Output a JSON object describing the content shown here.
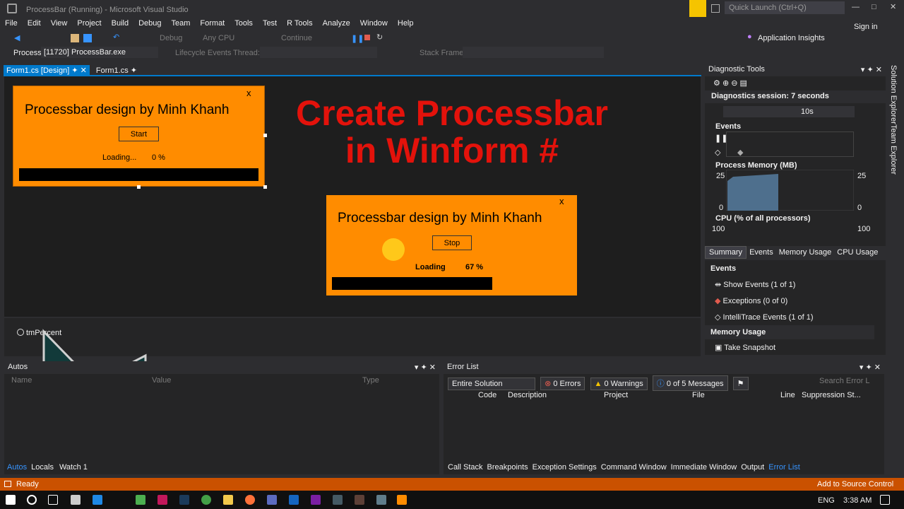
{
  "window": {
    "title": "ProcessBar (Running) - Microsoft Visual Studio",
    "quick_launch": "Quick Launch (Ctrl+Q)",
    "sign_in": "Sign in"
  },
  "menu": [
    "File",
    "Edit",
    "View",
    "Project",
    "Build",
    "Debug",
    "Team",
    "Format",
    "Tools",
    "Test",
    "R Tools",
    "Analyze",
    "Window",
    "Help"
  ],
  "toolbar": {
    "config": "Debug",
    "platform": "Any CPU",
    "continue": "Continue",
    "app_insights": "Application Insights"
  },
  "process_bar": {
    "label": "Process:",
    "process": "[11720] ProcessBar.exe",
    "lifecycle": "Lifecycle Events",
    "thread": "Thread:",
    "stack_frame": "Stack Frame:"
  },
  "tabs": [
    {
      "label": "Form1.cs [Design]"
    },
    {
      "label": "Form1.cs"
    }
  ],
  "form_design": {
    "title": "Processbar design by Minh Khanh",
    "button": "Start",
    "loading": "Loading...",
    "percent": "0 %",
    "close": "x",
    "progress": 0
  },
  "form_running": {
    "title": "Processbar design by Minh Khanh",
    "button": "Stop",
    "loading": "Loading",
    "percent": "67 %",
    "close": "x",
    "progress": 0.67
  },
  "overlay": {
    "line1": "Create Processbar",
    "line2": "in Winform #"
  },
  "tray": {
    "component": "tmPercent"
  },
  "diagnostics": {
    "title": "Diagnostic Tools",
    "session": "Diagnostics session: 7 seconds",
    "tick": "10s",
    "events": "Events",
    "memory": "Process Memory (MB)",
    "mem_max": "25",
    "mem_min": "0",
    "cpu": "CPU (% of all processors)",
    "cpu_max": "100",
    "tabs": [
      "Summary",
      "Events",
      "Memory Usage",
      "CPU Usage"
    ],
    "summary_events": "Events",
    "show_events": "Show Events (1 of 1)",
    "exceptions": "Exceptions (0 of 0)",
    "intellitrace": "IntelliTrace Events (1 of 1)",
    "memory_usage": "Memory Usage",
    "snapshot": "Take Snapshot"
  },
  "right_sidebar": [
    "Solution Explorer",
    "Team Explorer"
  ],
  "autos": {
    "title": "Autos",
    "columns": [
      "Name",
      "Value",
      "Type"
    ],
    "tabs": [
      "Autos",
      "Locals",
      "Watch 1"
    ]
  },
  "errors": {
    "title": "Error List",
    "scope": "Entire Solution",
    "errors": "0 Errors",
    "warnings": "0 Warnings",
    "messages": "0 of 5 Messages",
    "search": "Search Error L",
    "columns": [
      "Code",
      "Description",
      "Project",
      "File",
      "Line",
      "Suppression St..."
    ],
    "tabs": [
      "Call Stack",
      "Breakpoints",
      "Exception Settings",
      "Command Window",
      "Immediate Window",
      "Output",
      "Error List"
    ]
  },
  "status": {
    "text": "Ready",
    "source_control": "Add to Source Control"
  },
  "taskbar": {
    "lang": "ENG",
    "time": "3:38 AM"
  },
  "colors": {
    "accent": "#007acc",
    "form": "#ff8c00",
    "title_red": "#e3120b",
    "status": "#ca5100"
  }
}
